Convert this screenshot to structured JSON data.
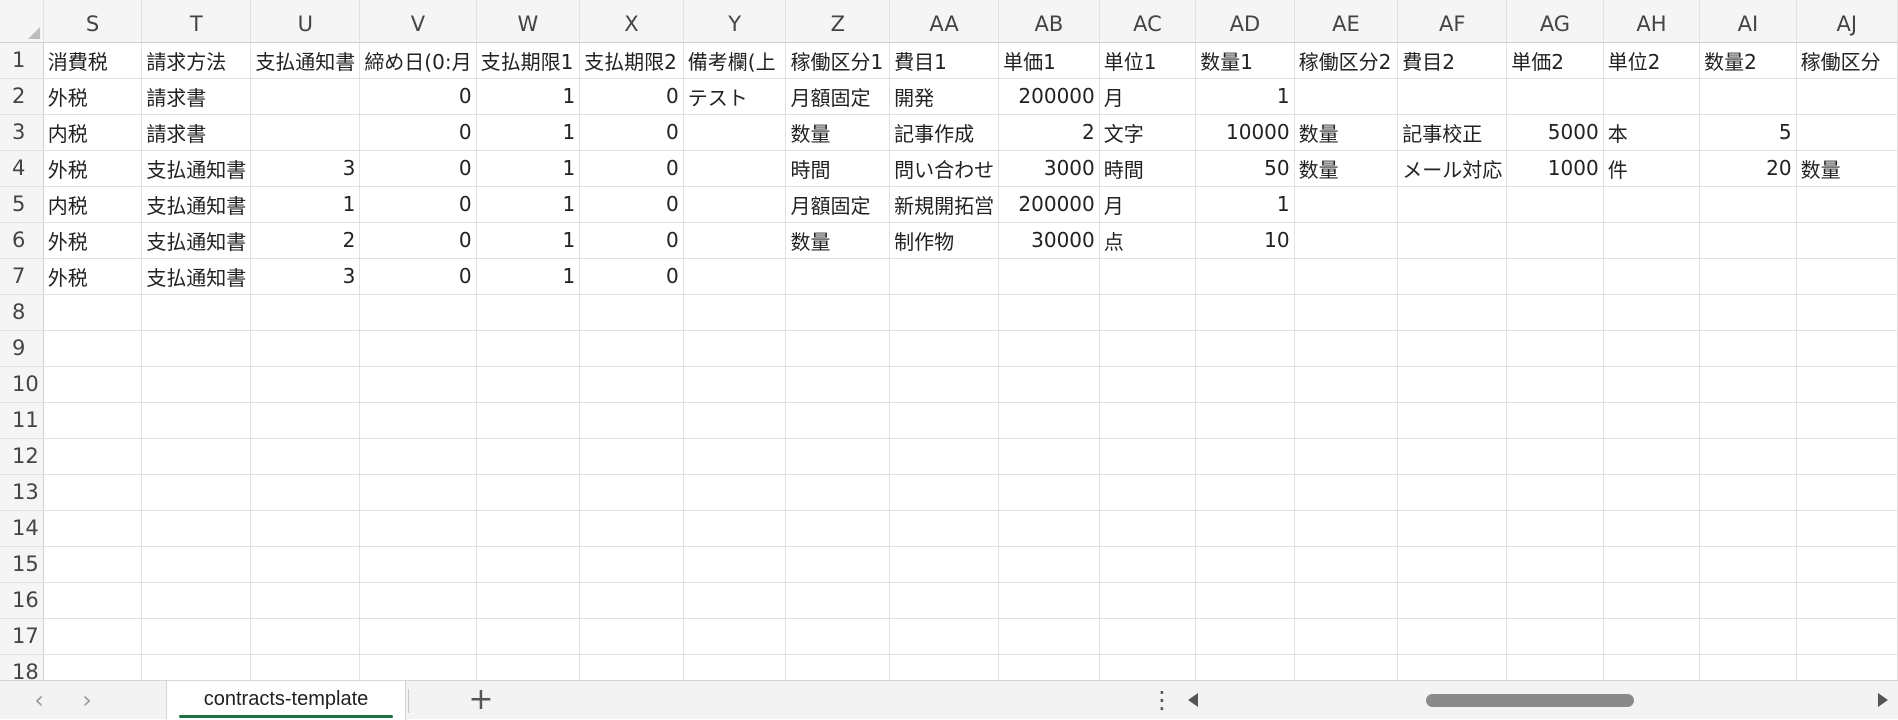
{
  "sheet": {
    "columns": [
      "S",
      "T",
      "U",
      "V",
      "W",
      "X",
      "Y",
      "Z",
      "AA",
      "AB",
      "AC",
      "AD",
      "AE",
      "AF",
      "AG",
      "AH",
      "AI",
      "AJ"
    ],
    "row_numbers": [
      "1",
      "2",
      "3",
      "4",
      "5",
      "6",
      "7",
      "8",
      "9",
      "10",
      "11",
      "12",
      "13",
      "14",
      "15",
      "16",
      "17",
      "18"
    ],
    "rows": [
      [
        "消費税",
        "請求方法",
        "支払通知書",
        "締め日(0:月",
        "支払期限1",
        "支払期限2",
        "備考欄(上",
        "稼働区分1",
        "費目1",
        "単価1",
        "単位1",
        "数量1",
        "稼働区分2",
        "費目2",
        "単価2",
        "単位2",
        "数量2",
        "稼働区分"
      ],
      [
        "外税",
        "請求書",
        "",
        "0",
        "1",
        "0",
        "テスト",
        "月額固定",
        "開発",
        "200000",
        "月",
        "1",
        "",
        "",
        "",
        "",
        "",
        ""
      ],
      [
        "内税",
        "請求書",
        "",
        "0",
        "1",
        "0",
        "",
        "数量",
        "記事作成",
        "2",
        "文字",
        "10000",
        "数量",
        "記事校正",
        "5000",
        "本",
        "5",
        ""
      ],
      [
        "外税",
        "支払通知書",
        "3",
        "0",
        "1",
        "0",
        "",
        "時間",
        "問い合わせ",
        "3000",
        "時間",
        "50",
        "数量",
        "メール対応",
        "1000",
        "件",
        "20",
        "数量"
      ],
      [
        "内税",
        "支払通知書",
        "1",
        "0",
        "1",
        "0",
        "",
        "月額固定",
        "新規開拓営",
        "200000",
        "月",
        "1",
        "",
        "",
        "",
        "",
        "",
        ""
      ],
      [
        "外税",
        "支払通知書",
        "2",
        "0",
        "1",
        "0",
        "",
        "数量",
        "制作物",
        "30000",
        "点",
        "10",
        "",
        "",
        "",
        "",
        "",
        ""
      ],
      [
        "外税",
        "支払通知書",
        "3",
        "0",
        "1",
        "0",
        "",
        "",
        "",
        "",
        "",
        "",
        "",
        "",
        "",
        "",
        "",
        ""
      ]
    ]
  },
  "sheet_tabs": {
    "active_tab": "contracts-template",
    "add_symbol": "+",
    "more_symbol": "⋮",
    "prev_symbol": "‹",
    "next_symbol": "›"
  },
  "colors": {
    "tab_underline": "#1e7145",
    "header_bg": "#f5f5f5",
    "gridline": "#e1e1e1"
  }
}
